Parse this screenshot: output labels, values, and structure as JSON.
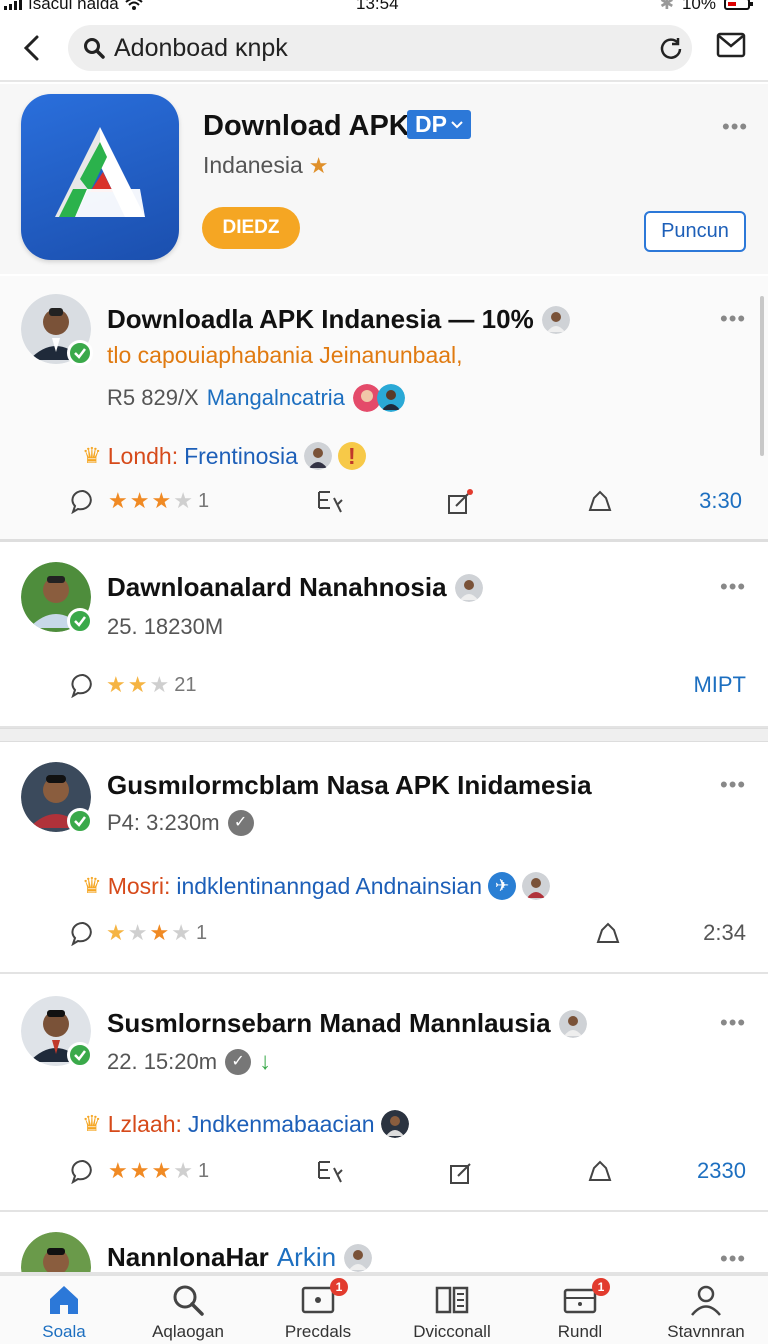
{
  "status_bar": {
    "carrier": "ısacul naida",
    "time": "13:54",
    "battery": "10%"
  },
  "header": {
    "search_value": "Adonboad ĸnpk"
  },
  "app": {
    "name": "Download APK",
    "badge": "DP",
    "subtitle": "Indanesia",
    "pill_label": "DIEDZ",
    "follow_label": "Puncun"
  },
  "posts": [
    {
      "title": "Downloadla APK Indanesia — 10%",
      "subtitle": "tlo capouiaphabania Jeinanunbaal,",
      "meta": "R5 829/X",
      "meta_link": "Mangalncatria",
      "tag_label": "Londh:",
      "tag_value": "Frentinosia",
      "stars_label": "★★★",
      "count": "1",
      "time": "3:30"
    },
    {
      "title": "Dawnloanalard Nanahnosia",
      "meta": "25. 18230M",
      "count": "21",
      "time": "MIPT"
    },
    {
      "title": "Gusmılormcblam Nasa APK Inidamesia",
      "meta": "P4: 3:230m",
      "tag_label": "Mosri:",
      "tag_value": "indklentinanngad Andnainsian",
      "count": "1",
      "time": "2:34"
    },
    {
      "title": "Susmlornsebarn Manad Mannlausia",
      "meta": "22. 15:20m",
      "tag_label": "Lzlaah:",
      "tag_value": "Jndkenmabaacian",
      "count": "1",
      "time": "2330"
    },
    {
      "title": "NannlonaHar",
      "title_link": "Arkin"
    }
  ],
  "bottom_nav": [
    {
      "label": "Soala",
      "icon": "home-icon"
    },
    {
      "label": "Aqlaogan",
      "icon": "search-icon"
    },
    {
      "label": "Precdals",
      "icon": "inbox-icon",
      "badge": "1"
    },
    {
      "label": "Dvicconall",
      "icon": "catalog-icon"
    },
    {
      "label": "Rundl",
      "icon": "wallet-icon",
      "badge": "1"
    },
    {
      "label": "Stavnnran",
      "icon": "profile-icon"
    }
  ],
  "colors": {
    "accent": "#1d6fc0",
    "orange": "#f5a623",
    "verified": "#3aa94a",
    "badge": "#e23b2e"
  }
}
